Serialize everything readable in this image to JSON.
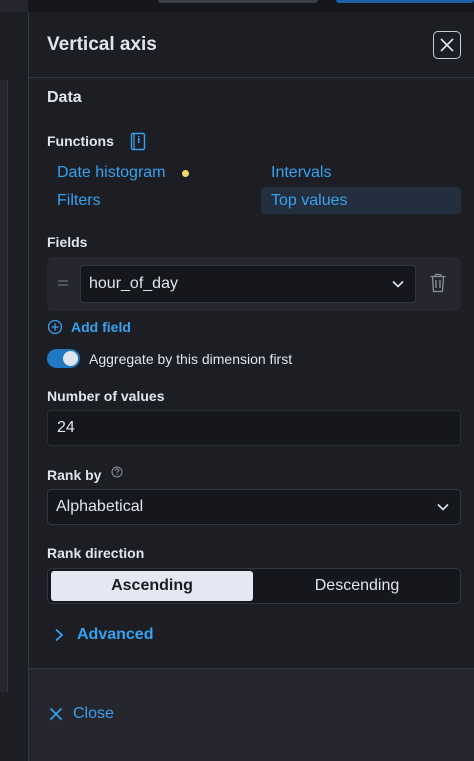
{
  "flyout": {
    "title": "Vertical axis",
    "section_title": "Data"
  },
  "functions": {
    "label": "Functions",
    "items": [
      {
        "label": "Date histogram",
        "has_indicator": true
      },
      {
        "label": "Intervals"
      },
      {
        "label": "Filters"
      },
      {
        "label": "Top values",
        "selected": true
      }
    ]
  },
  "fields": {
    "label": "Fields",
    "selected_field": "hour_of_day",
    "add_field_label": "Add field"
  },
  "aggregate": {
    "label": "Aggregate by this dimension first",
    "enabled": true
  },
  "number_of_values": {
    "label": "Number of values",
    "value": "24"
  },
  "rank_by": {
    "label": "Rank by",
    "value": "Alphabetical"
  },
  "rank_direction": {
    "label": "Rank direction",
    "options": [
      "Ascending",
      "Descending"
    ],
    "selected": "Ascending"
  },
  "advanced": {
    "label": "Advanced"
  },
  "footer": {
    "close_label": "Close"
  },
  "colors": {
    "link": "#36a2ef",
    "toggle_on": "#1f78c1",
    "indicator": "#f1d86f",
    "background": "#1d1e24"
  }
}
